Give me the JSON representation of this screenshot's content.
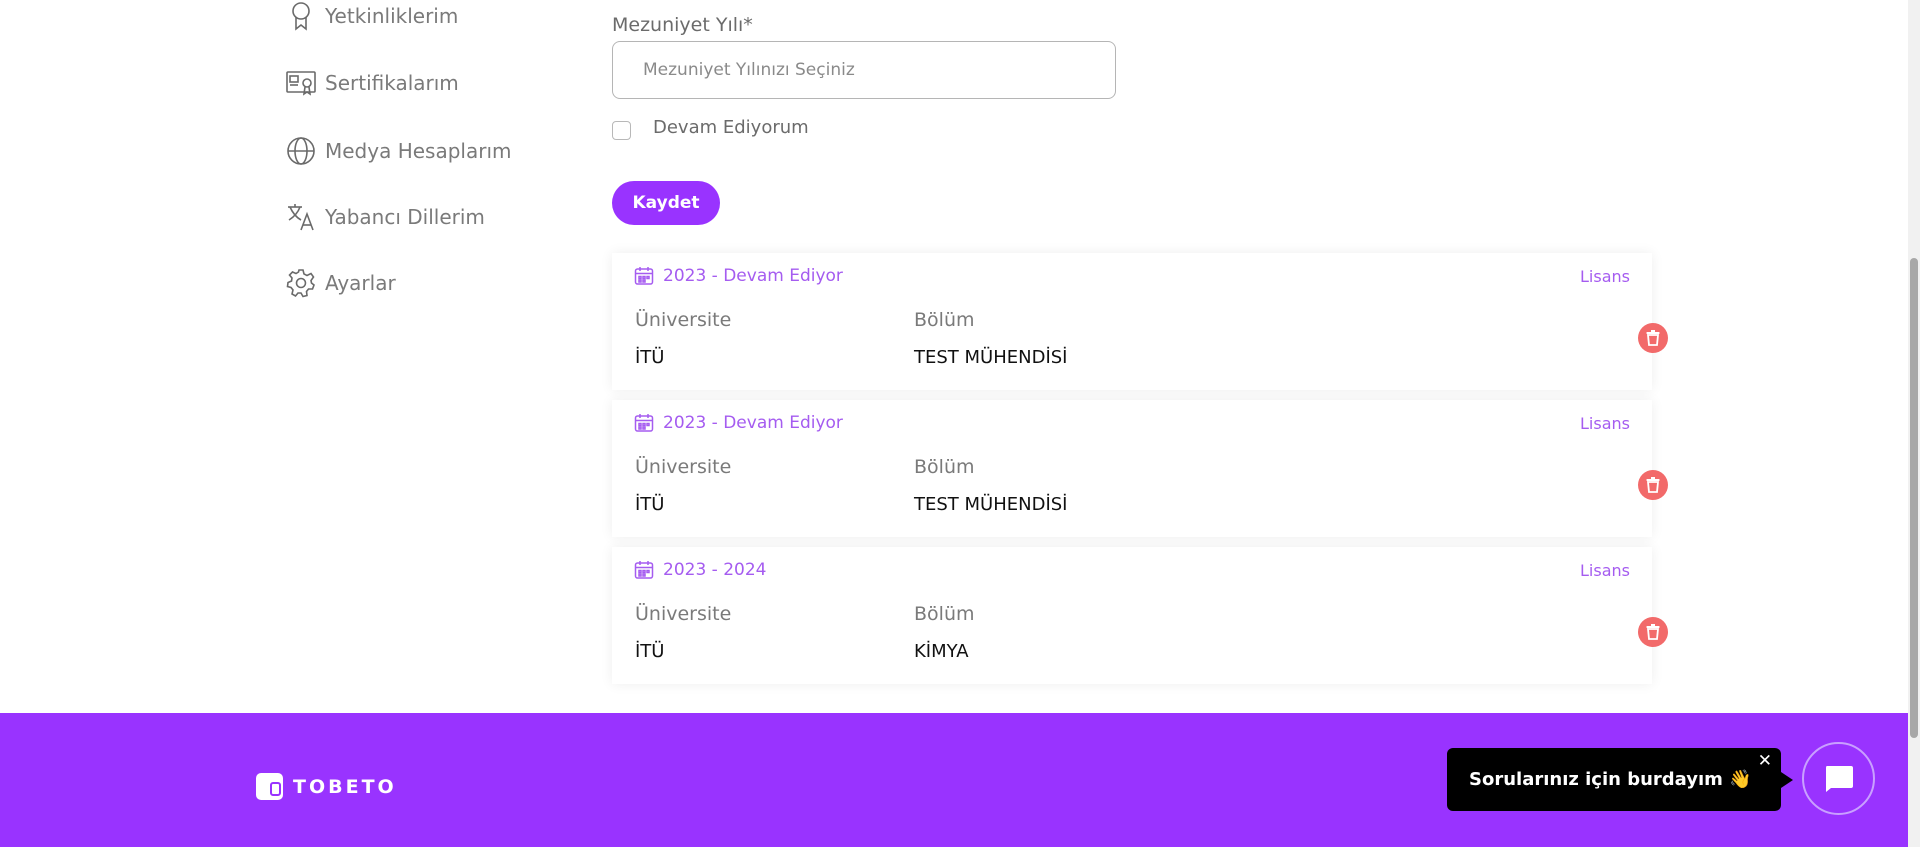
{
  "sidebar": {
    "items": [
      {
        "label": "Yetkinliklerim",
        "icon": "award-icon"
      },
      {
        "label": "Sertifikalarım",
        "icon": "certificate-icon"
      },
      {
        "label": "Medya Hesaplarım",
        "icon": "globe-icon"
      },
      {
        "label": "Yabancı Dillerim",
        "icon": "translate-icon"
      },
      {
        "label": "Ayarlar",
        "icon": "gear-icon"
      }
    ]
  },
  "form": {
    "graduation_label": "Mezuniyet Yılı*",
    "graduation_placeholder": "Mezuniyet Yılınızı Seçiniz",
    "graduation_value": "",
    "continuing_label": "Devam Ediyorum",
    "continuing_checked": false,
    "save_label": "Kaydet"
  },
  "education": [
    {
      "period": "2023 - Devam Ediyor",
      "degree": "Lisans",
      "university_label": "Üniversite",
      "university": "İTÜ",
      "department_label": "Bölüm",
      "department": "TEST MÜHENDİSİ"
    },
    {
      "period": "2023 - Devam Ediyor",
      "degree": "Lisans",
      "university_label": "Üniversite",
      "university": "İTÜ",
      "department_label": "Bölüm",
      "department": "TEST MÜHENDİSİ"
    },
    {
      "period": "2023 - 2024",
      "degree": "Lisans",
      "university_label": "Üniversite",
      "university": "İTÜ",
      "department_label": "Bölüm",
      "department": "KİMYA"
    }
  ],
  "footer": {
    "brand": "TOBETO"
  },
  "chat": {
    "message": "Sorularınız için burdayım 👋",
    "close": "✕"
  },
  "colors": {
    "accent": "#9933ff",
    "date_text": "#a55cf0",
    "delete": "#f26a6a"
  }
}
